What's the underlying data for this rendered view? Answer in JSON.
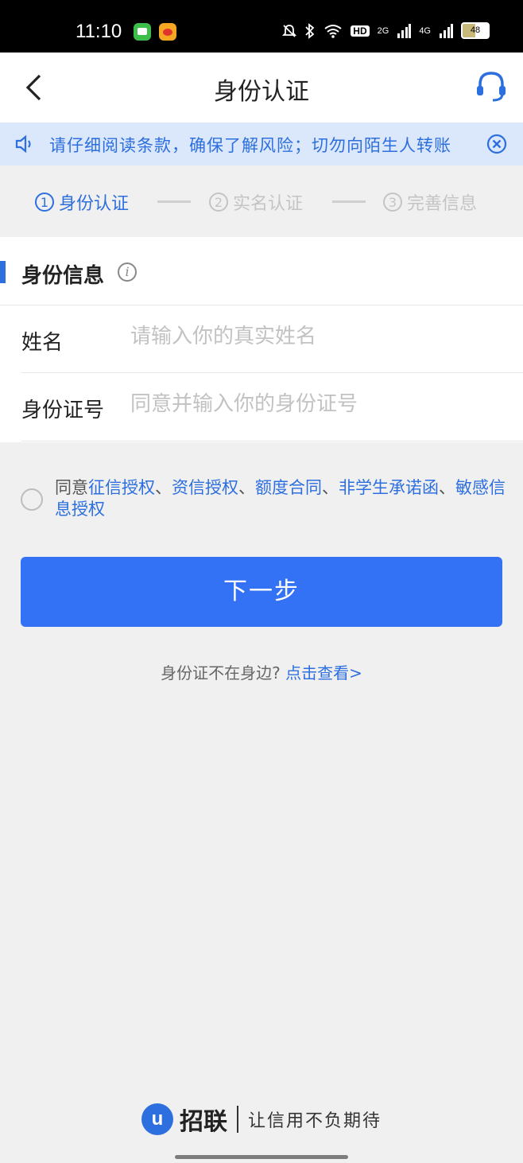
{
  "status_bar": {
    "time": "11:10",
    "signal_2g": "2G",
    "signal_4g": "4G",
    "hd": "HD",
    "battery": "48",
    "icons": [
      "messages-app-icon",
      "weibo-app-icon",
      "mute-icon",
      "bluetooth-icon",
      "wifi-icon",
      "signal-icon",
      "battery-icon"
    ]
  },
  "nav": {
    "title": "身份认证",
    "back_icon": "chevron-left-icon",
    "service_icon": "headset-icon"
  },
  "notice": {
    "text": "请仔细阅读条款，确保了解风险；切勿向陌生人转账",
    "icon": "speaker-icon",
    "close_icon": "close-circle-icon"
  },
  "steps": [
    {
      "num": "1",
      "label": "身份认证",
      "active": true
    },
    {
      "num": "2",
      "label": "实名认证",
      "active": false
    },
    {
      "num": "3",
      "label": "完善信息",
      "active": false
    }
  ],
  "form": {
    "section_title": "身份信息",
    "name_label": "姓名",
    "name_placeholder": "请输入你的真实姓名",
    "id_label": "身份证号",
    "id_placeholder": "同意并输入你的身份证号"
  },
  "agreement": {
    "prefix": "同意",
    "links": [
      "征信授权",
      "资信授权",
      "额度合同",
      "非学生承诺函",
      "敏感信息授权"
    ],
    "sep": "、"
  },
  "next_button": "下一步",
  "idcard_help": {
    "text": "身份证不在身边?",
    "link": "点击查看>"
  },
  "footer": {
    "logo_letter": "u",
    "brand": "招联",
    "slogan": "让信用不负期待"
  },
  "colors": {
    "primary": "#3372f5",
    "link": "#2d6fde",
    "notice_bg": "#dbe7fb",
    "page_bg": "#f0f0f0"
  }
}
